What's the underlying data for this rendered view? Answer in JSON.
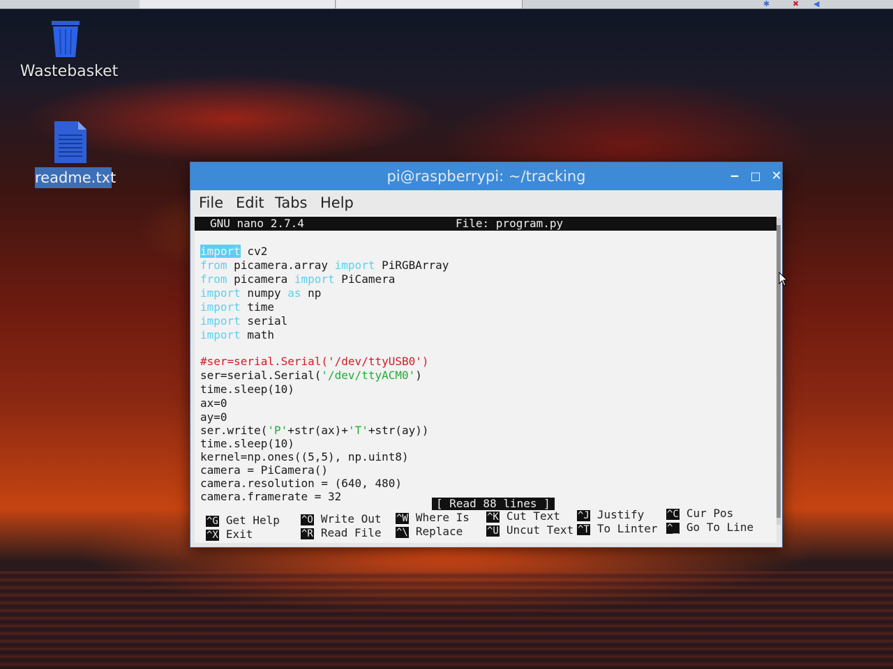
{
  "desktop": {
    "icons": [
      {
        "label": "Wastebasket",
        "icon": "trash-icon"
      },
      {
        "label": "readme.txt",
        "icon": "text-file-icon"
      }
    ]
  },
  "window": {
    "title": "pi@raspberrypi: ~/tracking",
    "controls": {
      "minimize": "‒",
      "maximize": "□",
      "close": "✕"
    }
  },
  "menu": {
    "items": [
      "File",
      "Edit",
      "Tabs",
      "Help"
    ]
  },
  "nano": {
    "header_left": "GNU nano 2.7.4",
    "header_right": "File: program.py",
    "status": "[ Read 88 lines ]",
    "code": [
      {
        "kw": "import",
        "rest": " cv2"
      },
      {
        "kw": "from",
        "rest": " picamera.array ",
        "kw2": "import",
        "rest2": " PiRGBArray"
      },
      {
        "kw": "from",
        "rest": " picamera ",
        "kw2": "import",
        "rest2": " PiCamera"
      },
      {
        "kw": "import",
        "rest": " numpy ",
        "kw2": "as",
        "rest2": " np"
      },
      {
        "kw": "import",
        "rest": " time"
      },
      {
        "kw": "import",
        "rest": " serial"
      },
      {
        "kw": "import",
        "rest": " math"
      }
    ],
    "comment_line": "#ser=serial.Serial('/dev/ttyUSB0')",
    "serial_pre": "ser=serial.Serial(",
    "serial_str": "'/dev/ttyACM0'",
    "serial_post": ")",
    "plain_1": "time.sleep(10)",
    "plain_2": "ax=0",
    "plain_3": "ay=0",
    "write_a": "ser.write(",
    "write_p": "'P'",
    "write_b": "+str(ax)+",
    "write_t": "'T'",
    "write_c": "+str(ay))",
    "plain_4": "time.sleep(10)",
    "plain_5": "kernel=np.ones((5,5), np.uint8)",
    "plain_6": "camera = PiCamera()",
    "plain_7": "camera.resolution = (640, 480)",
    "plain_8": "camera.framerate = 32",
    "shortcuts": [
      {
        "key": "^G",
        "label": "Get Help"
      },
      {
        "key": "^X",
        "label": "Exit"
      },
      {
        "key": "^O",
        "label": "Write Out"
      },
      {
        "key": "^R",
        "label": "Read File"
      },
      {
        "key": "^W",
        "label": "Where Is"
      },
      {
        "key": "^\\",
        "label": "Replace"
      },
      {
        "key": "^K",
        "label": "Cut Text"
      },
      {
        "key": "^U",
        "label": "Uncut Text"
      },
      {
        "key": "^J",
        "label": "Justify"
      },
      {
        "key": "^T",
        "label": "To Linter"
      },
      {
        "key": "^C",
        "label": "Cur Pos"
      },
      {
        "key": "^_",
        "label": "Go To Line"
      }
    ]
  },
  "colors": {
    "titlebar": "#3d8ad6",
    "keyword": "#5ad0f0",
    "comment": "#d01c24",
    "string": "#1fae37"
  }
}
